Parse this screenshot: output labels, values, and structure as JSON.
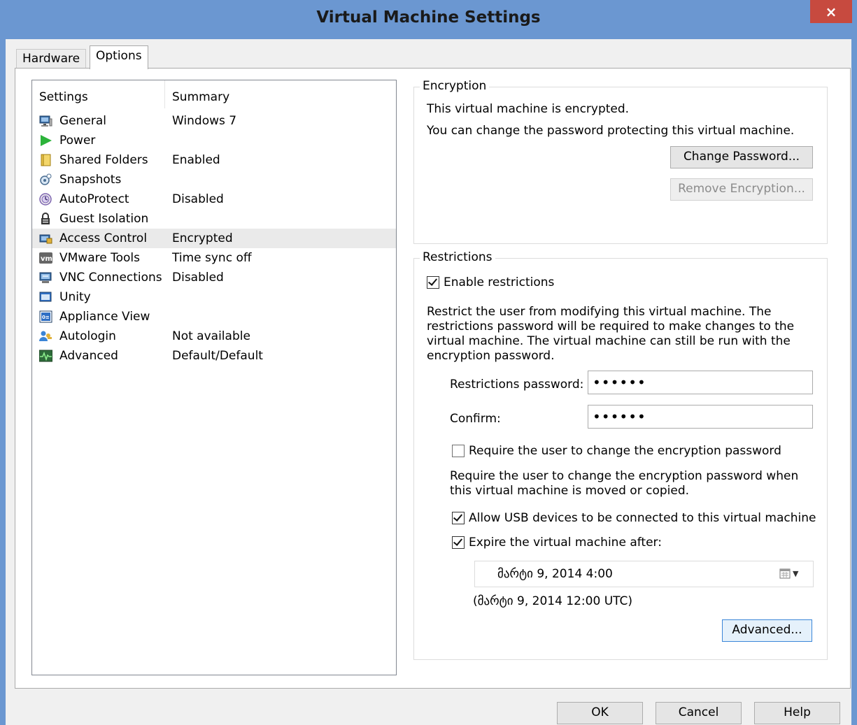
{
  "window": {
    "title": "Virtual Machine Settings",
    "close_label": "×"
  },
  "tabs": [
    {
      "label": "Hardware"
    },
    {
      "label": "Options"
    }
  ],
  "settings_list": {
    "col_settings": "Settings",
    "col_summary": "Summary",
    "items": [
      {
        "name": "General",
        "summary": "Windows 7",
        "icon": "monitor-icon"
      },
      {
        "name": "Power",
        "summary": "",
        "icon": "play-icon"
      },
      {
        "name": "Shared Folders",
        "summary": "Enabled",
        "icon": "folder-icon"
      },
      {
        "name": "Snapshots",
        "summary": "",
        "icon": "snapshot-icon"
      },
      {
        "name": "AutoProtect",
        "summary": "Disabled",
        "icon": "clock-icon"
      },
      {
        "name": "Guest Isolation",
        "summary": "",
        "icon": "lock-icon"
      },
      {
        "name": "Access Control",
        "summary": "Encrypted",
        "icon": "access-control-icon"
      },
      {
        "name": "VMware Tools",
        "summary": "Time sync off",
        "icon": "vm-icon"
      },
      {
        "name": "VNC Connections",
        "summary": "Disabled",
        "icon": "vnc-icon"
      },
      {
        "name": "Unity",
        "summary": "",
        "icon": "unity-icon"
      },
      {
        "name": "Appliance View",
        "summary": "",
        "icon": "appliance-icon"
      },
      {
        "name": "Autologin",
        "summary": "Not available",
        "icon": "users-icon"
      },
      {
        "name": "Advanced",
        "summary": "Default/Default",
        "icon": "pulse-icon"
      }
    ],
    "selected": "Access Control"
  },
  "encryption": {
    "legend": "Encryption",
    "status": "This virtual machine is encrypted.",
    "change_hint": "You can change the password protecting this virtual machine.",
    "change_password_label": "Change Password...",
    "remove_encryption_label": "Remove Encryption..."
  },
  "restrictions": {
    "legend": "Restrictions",
    "enable_label": "Enable restrictions",
    "enable_checked": true,
    "description_lines": [
      "Restrict the user from modifying this virtual machine. The",
      "restrictions password will be required to make changes to the",
      "virtual machine. The virtual machine can still be run with the",
      "encryption password."
    ],
    "password_label": "Restrictions password:",
    "password_value": "••••••",
    "confirm_label": "Confirm:",
    "confirm_value": "••••••",
    "require_change_label": "Require the user to change the encryption password",
    "require_change_checked": false,
    "require_change_hint_lines": [
      "Require the user to change the encryption password when",
      "this virtual machine is moved or copied."
    ],
    "allow_usb_label": "Allow USB devices to be connected to this virtual machine",
    "allow_usb_checked": true,
    "expire_label": "Expire the virtual machine after:",
    "expire_checked": true,
    "expire_date": "მარტი      9, 2014   4:00",
    "expire_utc": "(მარტი 9, 2014 12:00 UTC)",
    "advanced_label": "Advanced..."
  },
  "footer": {
    "ok_label": "OK",
    "cancel_label": "Cancel",
    "help_label": "Help"
  }
}
